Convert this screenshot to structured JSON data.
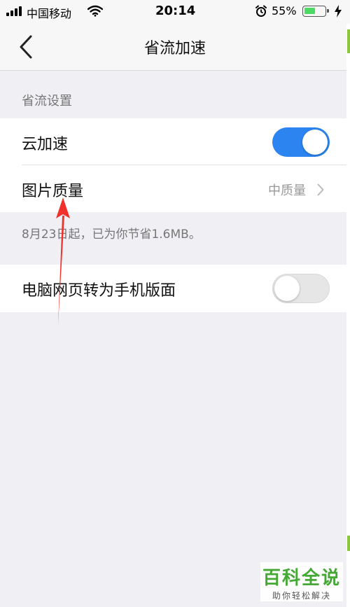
{
  "status_bar": {
    "carrier": "中国移动",
    "time": "20:14",
    "battery_percent": "55%",
    "battery_level": 0.55,
    "battery_color": "#4cd964"
  },
  "nav": {
    "title": "省流加速",
    "back_icon": "chevron-left-icon"
  },
  "section": {
    "header": "省流设置"
  },
  "settings": {
    "cloud_accel": {
      "label": "云加速",
      "enabled": true
    },
    "image_quality": {
      "label": "图片质量",
      "value": "中质量"
    },
    "savings_note": "8月23日起，已为你节省1.6MB。",
    "desktop_to_mobile": {
      "label": "电脑网页转为手机版面",
      "enabled": false
    }
  },
  "colors": {
    "accent": "#2b84f0",
    "annotation": "#f0302a",
    "watermark": "#45a834"
  },
  "watermark": {
    "title": "百科全说",
    "subtitle": "助你轻松解决"
  }
}
